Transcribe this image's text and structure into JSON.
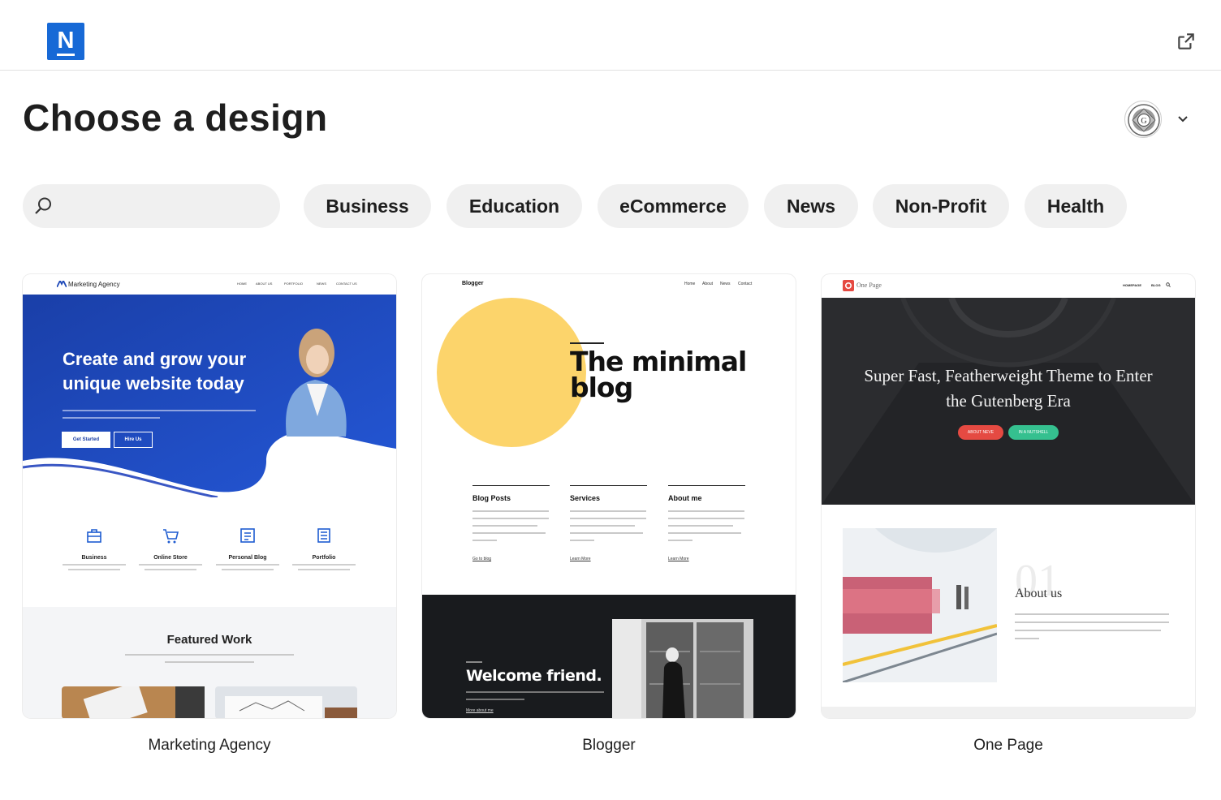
{
  "header": {
    "logo_letter": "N",
    "title": "Choose a design"
  },
  "search": {
    "placeholder": ""
  },
  "categories": [
    "Business",
    "Education",
    "eCommerce",
    "News",
    "Non-Profit",
    "Health"
  ],
  "designs": [
    {
      "name": "Marketing Agency",
      "preview": {
        "brand": "Marketing Agency",
        "nav": [
          "HOME",
          "ABOUT US",
          "PORTFOLIO",
          "NEWS",
          "CONTACT US"
        ],
        "headline": "Create and grow your unique website today",
        "primary_button": "Get Started",
        "secondary_button": "Hire Us",
        "features": [
          "Business",
          "Online Store",
          "Personal Blog",
          "Portfolio"
        ],
        "section_title": "Featured Work"
      }
    },
    {
      "name": "Blogger",
      "preview": {
        "brand": "Blogger",
        "nav": [
          "Home",
          "About",
          "News",
          "Contact"
        ],
        "headline": "The minimal blog",
        "columns": [
          "Blog Posts",
          "Services",
          "About me"
        ],
        "column_links": [
          "Go to blog",
          "Learn More",
          "Learn More"
        ],
        "welcome": "Welcome friend.",
        "welcome_link": "More about me"
      }
    },
    {
      "name": "One Page",
      "preview": {
        "brand": "One Page",
        "nav": [
          "HOMEPAGE",
          "BLOG"
        ],
        "headline": "Super Fast, Featherweight Theme to Enter the Gutenberg Era",
        "button_1": "ABOUT NEVE",
        "button_2": "IN A NUTSHELL",
        "section_number": "01",
        "section_title": "About us"
      }
    }
  ],
  "colors": {
    "logo": "#1769d6",
    "chip_bg": "#f0f0f0",
    "marketing_blue": "#1d48b8",
    "blogger_yellow": "#fcd46b",
    "onepage_red": "#e54a42",
    "onepage_green": "#35c08f"
  }
}
